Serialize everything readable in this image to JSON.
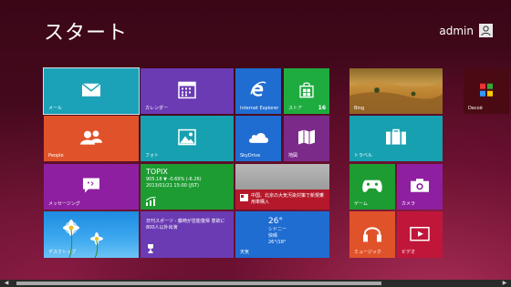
{
  "header": {
    "title": "スタート",
    "user": "admin"
  },
  "tiles": {
    "mail": "メール",
    "calendar": "カレンダー",
    "ie": "Internet Explorer",
    "store": "ストア",
    "store_badge": "16",
    "bing": "Bing",
    "decoe": "Decoё",
    "people": "People",
    "photos": "フォト",
    "skydrive": "SkyDrive",
    "maps": "地図",
    "travel": "トラベル",
    "messaging": "メッセージング",
    "finance_title": "TOPIX",
    "finance_line1": "905.18 ▼ -0.69% (-6.26)",
    "finance_line2": "2013/01/21 15:00 (JST)",
    "news_headline": "中国、北京の大気汚染対策で新規乗用車購入",
    "games": "ゲーム",
    "camera": "カメラ",
    "desktop": "デスクトップ",
    "sports_headline": "日刊スポーツ - 藤崎が芸能復帰 意欲に 800人以外出演",
    "weather_temp": "26°",
    "weather_city": "シドニー",
    "weather_cond": "快晴",
    "weather_range": "26°/18°",
    "weather": "天気",
    "music": "ミュージック",
    "video": "ビデオ"
  }
}
